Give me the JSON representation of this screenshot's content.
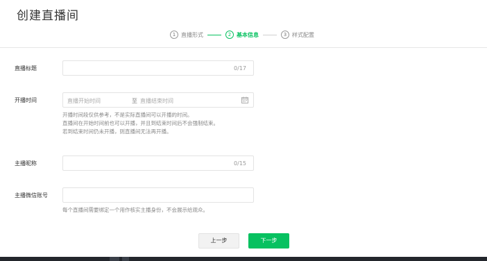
{
  "page": {
    "title": "创建直播间"
  },
  "steps": [
    {
      "num": "①",
      "label": "直播形式",
      "active": false
    },
    {
      "num": "②",
      "label": "基本信息",
      "active": true
    },
    {
      "num": "③",
      "label": "样式配置",
      "active": false
    }
  ],
  "form": {
    "title": {
      "label": "直播标题",
      "value": "",
      "counter": "0/17"
    },
    "time": {
      "label": "开播时间",
      "start_placeholder": "直播开始时间",
      "separator": "至",
      "end_placeholder": "直播结束时间",
      "hints": [
        "开播时间段仅供参考，不是实际直播间可以开播的时间。",
        "直播间在开始时间前也可以开播，并且到结束时间后不会强制结束。",
        "若到结束时间仍未开播，则直播间无法再开播。"
      ]
    },
    "nickname": {
      "label": "主播昵称",
      "value": "",
      "counter": "0/15"
    },
    "wechat": {
      "label": "主播微信账号",
      "value": "",
      "hint": "每个直播间需要绑定一个用作核实主播身份，不会展示给观众。"
    }
  },
  "buttons": {
    "prev": "上一步",
    "next": "下一步"
  },
  "colors": {
    "accent": "#07c160",
    "taskbar": "#23262c"
  },
  "icons": {
    "calendar": "calendar-icon"
  }
}
